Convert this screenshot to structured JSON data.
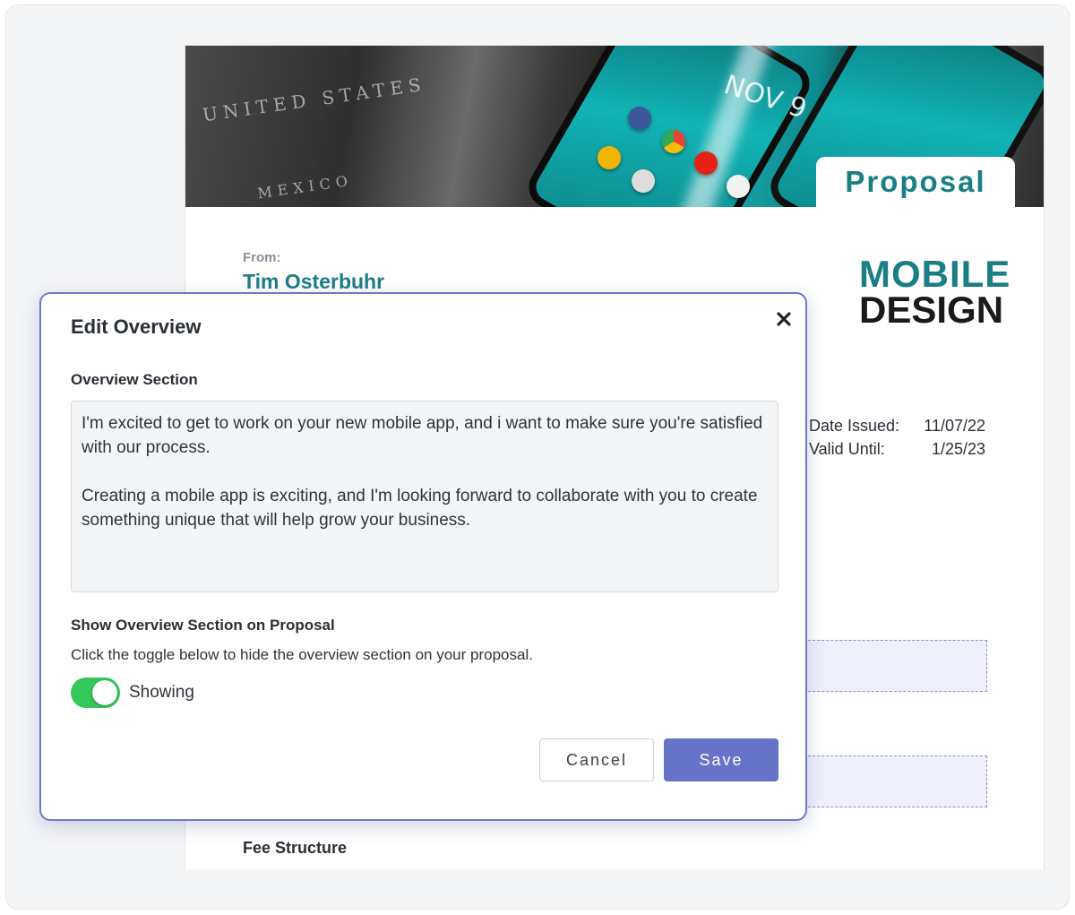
{
  "proposal": {
    "title": "Proposal",
    "from_label": "From:",
    "from_name": "Tim Osterbuhr",
    "logo_line1": "MOBILE",
    "logo_line2": "DESIGN",
    "date_issued_label": "Date Issued:",
    "date_issued": "11/07/22",
    "valid_until_label": "Valid Until:",
    "valid_until": "1/25/23",
    "fee_structure_title": "Fee Structure",
    "hero": {
      "map_text": "UNITED STATES",
      "map_text_2": "MEXICO",
      "phone_date": "NOV 9"
    }
  },
  "modal": {
    "title": "Edit Overview",
    "overview_label": "Overview Section",
    "overview_text": "I'm excited to get to work on your new mobile app, and i want to make sure you're satisfied with our process.\n\nCreating a mobile app is exciting, and I'm looking forward to collaborate with you to create something unique that will help grow your business.",
    "show_label": "Show Overview Section on Proposal",
    "show_desc": "Click the toggle below to hide the overview section on your proposal.",
    "toggle_state": "Showing",
    "toggle_on": true,
    "cancel_label": "Cancel",
    "save_label": "Save"
  },
  "colors": {
    "accent": "#1b7e85",
    "primary_button": "#6674c8",
    "modal_border": "#6f78cc",
    "toggle_on": "#34c759"
  },
  "icons": {
    "close": "close-icon"
  }
}
